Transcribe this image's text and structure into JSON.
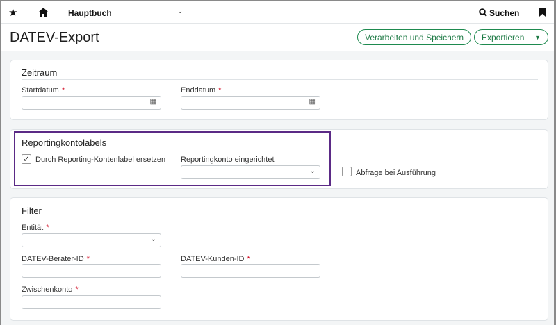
{
  "topbar": {
    "module": "Hauptbuch",
    "search": "Suchen",
    "icons": [
      "star-icon",
      "home-icon",
      "chevron-down-icon",
      "search-icon",
      "bookmark-icon"
    ]
  },
  "page": {
    "title": "DATEV-Export",
    "save_button": "Verarbeiten und Speichern",
    "export_button": "Exportieren"
  },
  "zeitraum": {
    "title": "Zeitraum",
    "start_label": "Startdatum",
    "end_label": "Enddatum",
    "start_value": "",
    "end_value": ""
  },
  "reporting": {
    "title": "Reportingkontolabels",
    "replace_label": "Durch Reporting-Kontenlabel ersetzen",
    "replace_checked": true,
    "account_label": "Reportingkonto eingerichtet",
    "query_label": "Abfrage bei Ausführung",
    "query_checked": false
  },
  "filter": {
    "title": "Filter",
    "entity_label": "Entität",
    "advisor_label": "DATEV-Berater-ID",
    "client_label": "DATEV-Kunden-ID",
    "intermediate_label": "Zwischenkonto"
  },
  "required_mark": "*",
  "colors": {
    "accent": "#1e8a4f",
    "highlight": "#5b2a86",
    "required": "#d0021b"
  }
}
